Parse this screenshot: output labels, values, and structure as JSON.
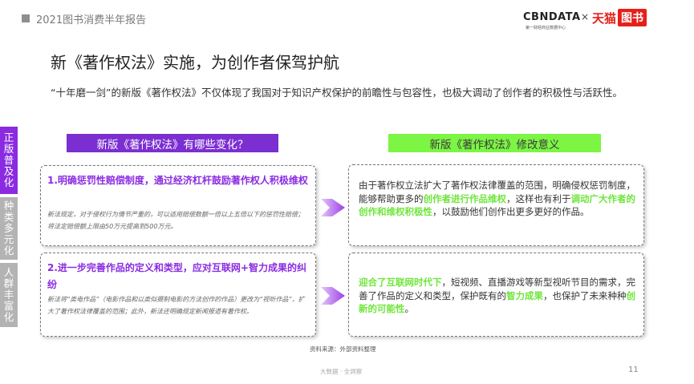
{
  "header": {
    "report_title": "2021图书消费半年报告",
    "logo_cbn": "CBNDATA",
    "logo_cbn_sub": "第一财经商业数据中心",
    "logo_x": "×",
    "logo_tmall": "天猫",
    "logo_book": "图书"
  },
  "page": {
    "title": "新《著作权法》实施，为创作者保驾护航",
    "intro": "“十年磨一剑”的新版《著作权法》不仅体现了我国对于知识产权保护的前瞻性与包容性，也极大调动了创作者的积极性与活跃性。"
  },
  "sidebar": {
    "tabs": [
      {
        "lines": [
          "正",
          "版",
          "普",
          "及",
          "化"
        ],
        "active": true
      },
      {
        "lines": [
          "种",
          "类",
          "多",
          "元",
          "化"
        ],
        "active": false
      },
      {
        "lines": [
          "人",
          "群",
          "丰",
          "富",
          "化"
        ],
        "active": false
      }
    ]
  },
  "columns": {
    "left_header": "新版《著作权法》有哪些变化？",
    "right_header": "新版《著作权法》修改意义"
  },
  "changes": [
    {
      "heading": "1.明确惩罚性赔偿制度，通过经济杠杆鼓励著作权人积极维权",
      "note": "新法规定，对于侵权行为情节严重的，可以适用赔偿数额一倍以上五倍以下的惩罚性赔偿；将法定赔偿额上限由50万元提高到500万元。"
    },
    {
      "heading": "2.进一步完善作品的定义和类型，应对互联网+智力成果的纠纷",
      "note": "新法将“类电作品”（电影作品和以类似摄制电影的方法创作的作品）更改为“视听作品”，扩大了著作权法律覆盖的范围；此外，新法还明确规定新闻报道有著作权。"
    }
  ],
  "meanings": [
    {
      "segments": [
        {
          "text": "由于著作权立法扩大了著作权法律覆盖的范围，明确侵权惩罚制度，能够帮助更多的",
          "hl": false
        },
        {
          "text": "创作者进行作品维权",
          "hl": true
        },
        {
          "text": "，这样也有利于",
          "hl": false
        },
        {
          "text": "调动广大作者的创作和维权积极性",
          "hl": true
        },
        {
          "text": "，以鼓励他们创作出更多更好的作品。",
          "hl": false
        }
      ]
    },
    {
      "segments": [
        {
          "text": "迎合了互联网时代下",
          "hl": true
        },
        {
          "text": "，短视频、直播游戏等新型视听节目的需求，完善了作品的定义和类型，保护既有的",
          "hl": false
        },
        {
          "text": "智力成果",
          "hl": true
        },
        {
          "text": "，也保护了未来种种",
          "hl": false
        },
        {
          "text": "创新的可能性",
          "hl": true
        },
        {
          "text": "。",
          "hl": false
        }
      ]
    }
  ],
  "footer": {
    "source": "资料来源：外部资料整理",
    "brand": "大数据 · 全洞察",
    "page_number": "11"
  },
  "colors": {
    "purple": "#8a2be2",
    "green": "#7cf544",
    "tmall_red": "#e5201b"
  }
}
